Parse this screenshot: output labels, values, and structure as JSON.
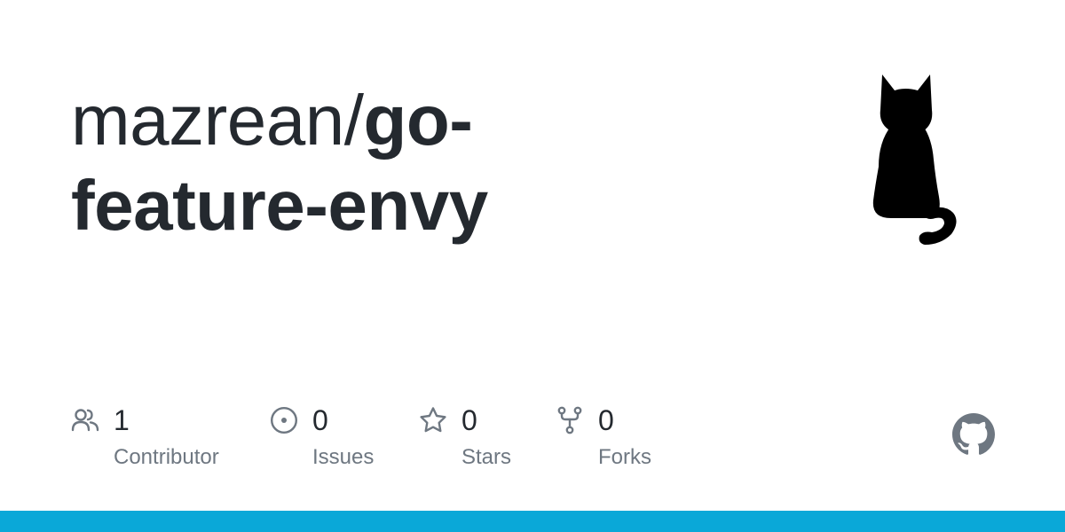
{
  "repo": {
    "owner": "mazrean/",
    "name_line1": "go-",
    "name_line2": "feature-envy"
  },
  "stats": [
    {
      "icon": "people-icon",
      "count": "1",
      "label": "Contributor"
    },
    {
      "icon": "issue-opened-icon",
      "count": "0",
      "label": "Issues"
    },
    {
      "icon": "star-icon",
      "count": "0",
      "label": "Stars"
    },
    {
      "icon": "repo-forked-icon",
      "count": "0",
      "label": "Forks"
    }
  ],
  "colors": {
    "title": "#24292f",
    "label": "#6e7781",
    "icon": "#6e7781",
    "accent_bar": "#0aa8d8",
    "logo": "#6e7781"
  },
  "icons": {
    "avatar": "cat-silhouette-icon",
    "brand": "github-mark-icon"
  }
}
